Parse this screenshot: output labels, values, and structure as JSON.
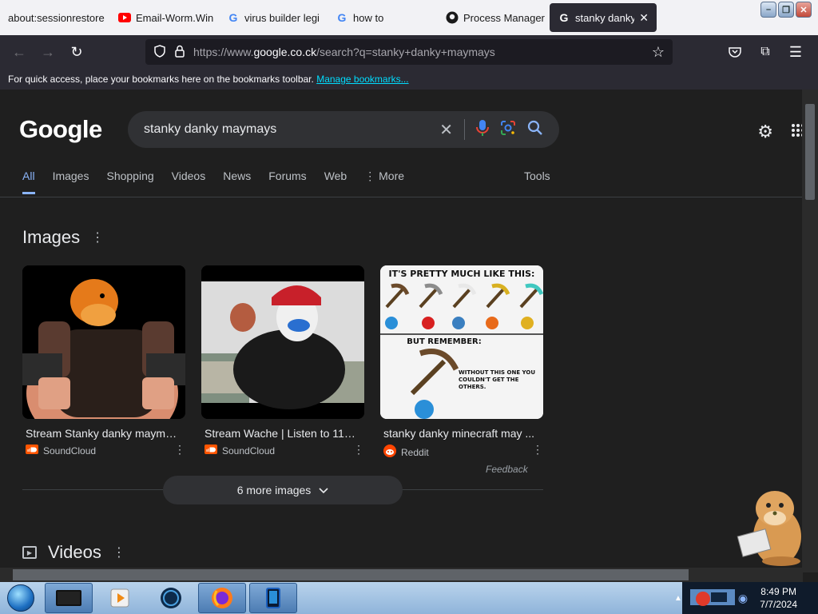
{
  "browser": {
    "tabs": [
      {
        "label": "about:sessionrestore",
        "icon": "none",
        "active": false
      },
      {
        "label": "Email-Worm.Win",
        "icon": "youtube-icon",
        "active": false
      },
      {
        "label": "virus builder legi",
        "icon": "google-icon",
        "active": false
      },
      {
        "label": "how to",
        "icon": "google-icon",
        "active": false
      },
      {
        "label": "Process Manager",
        "icon": "github-icon",
        "active": false
      },
      {
        "label": "stanky danky m",
        "icon": "google-icon",
        "active": true
      }
    ],
    "url_prefix": "https://www.",
    "url_host": "google.co.ck",
    "url_path": "/search?q=stanky+danky+maymays",
    "bookmarks_text": "For quick access, place your bookmarks here on the bookmarks toolbar.",
    "bookmarks_link": "Manage bookmarks..."
  },
  "google": {
    "logo": "Google",
    "query": "stanky danky maymays",
    "tabs": [
      "All",
      "Images",
      "Shopping",
      "Videos",
      "News",
      "Forums",
      "Web",
      "More"
    ],
    "tools": "Tools",
    "images_title": "Images",
    "images": [
      {
        "title": "Stream Stanky danky mayma...",
        "source": "SoundCloud"
      },
      {
        "title": "Stream Wache | Listen to 11/1...",
        "source": "SoundCloud"
      },
      {
        "title": "stanky danky minecraft may ...",
        "source": "Reddit"
      }
    ],
    "meme_top": "IT'S PRETTY MUCH LIKE THIS:",
    "meme_mid": "BUT REMEMBER:",
    "meme_bottom": "WITHOUT THIS ONE YOU COULDN'T GET THE OTHERS.",
    "feedback": "Feedback",
    "more_images": "6 more images",
    "videos_title": "Videos"
  },
  "taskbar": {
    "time": "8:49 PM",
    "date": "7/7/2024"
  },
  "colors": {
    "accent": "#8ab4f8",
    "page_bg": "#1f1f1f",
    "chrome_bg": "#2b2a33"
  }
}
